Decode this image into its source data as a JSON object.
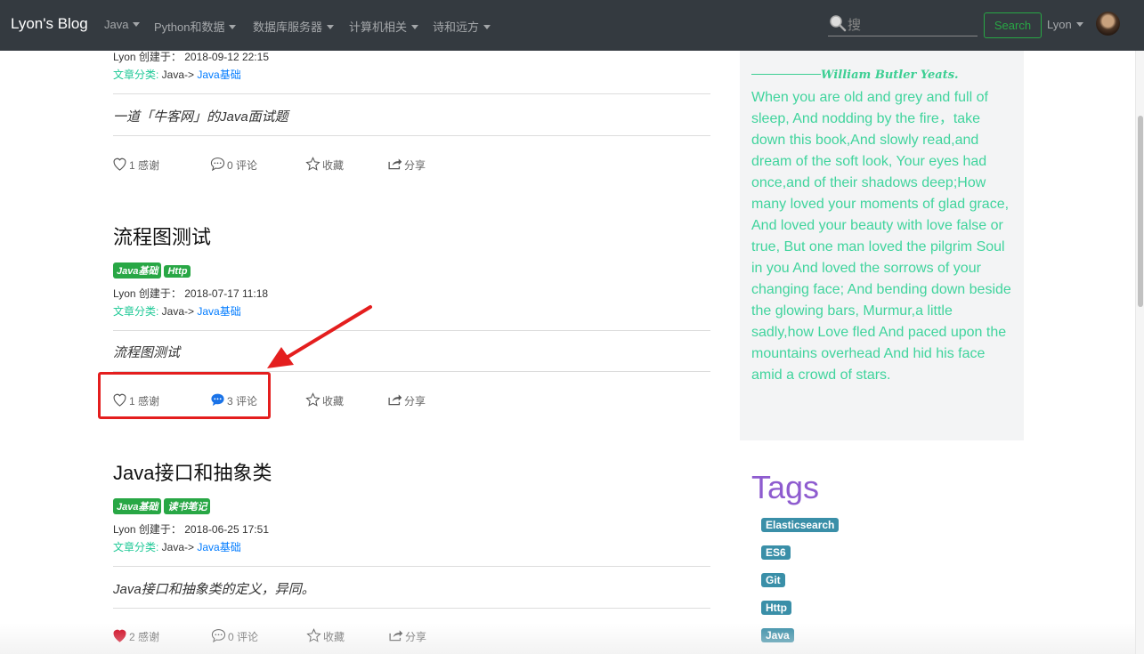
{
  "navbar": {
    "brand": "Lyon's Blog",
    "items": [
      "Java",
      "Python和数据",
      "数据库服务器",
      "计算机相关",
      "诗和远方"
    ],
    "search_placeholder": "搜",
    "search_button": "Search",
    "user": "Lyon"
  },
  "posts": [
    {
      "meta": "Lyon 创建于：  2018-09-12 22:15",
      "category_label": "文章分类:",
      "category_path": " Java-> ",
      "category_link": "Java基础",
      "summary": "一道「牛客网」的Java面试题",
      "likes": "1 感谢",
      "comments": "0 评论",
      "favorite": "收藏",
      "share": "分享"
    },
    {
      "title": "流程图测试",
      "tags": [
        "Java基础",
        "Http"
      ],
      "meta": "Lyon 创建于：  2018-07-17 11:18",
      "category_label": "文章分类:",
      "category_path": " Java-> ",
      "category_link": "Java基础",
      "summary": "流程图测试",
      "likes": "1 感谢",
      "comments": "3 评论",
      "favorite": "收藏",
      "share": "分享"
    },
    {
      "title": "Java接口和抽象类",
      "tags": [
        "Java基础",
        "读书笔记"
      ],
      "meta": "Lyon 创建于：  2018-06-25 17:51",
      "category_label": "文章分类:",
      "category_path": " Java-> ",
      "category_link": "Java基础",
      "summary": "Java接口和抽象类的定义，异同。",
      "likes": "2 感谢",
      "comments": "0 评论",
      "favorite": "收藏",
      "share": "分享"
    }
  ],
  "sidebar": {
    "poem_author": "William Butler Yeats.",
    "poem_text": "When you are old and grey and full of sleep, And nodding by the fire，take down this book,And slowly read,and dream of the soft look, Your eyes had once,and of their shadows deep;How many loved your moments of glad grace, And loved your beauty with love false or true, But one man loved the pilgrim Soul in you And loved the sorrows of your changing face; And bending down beside the glowing bars, Murmur,a little sadly,how Love fled And paced upon the mountains overhead And hid his face amid a crowd of stars.",
    "tags_heading": "Tags",
    "tags": [
      "Elasticsearch",
      "ES6",
      "Git",
      "Http",
      "Java"
    ]
  },
  "colors": {
    "navbar_bg": "#343a40",
    "post_tag": "#28a745",
    "side_tag": "#3a8fa8",
    "poem_text": "#40d49d",
    "tags_heading": "#8e5ccf",
    "highlight": "#e41e1e",
    "liked_heart": "#d0021b",
    "active_comment": "#1a73e8"
  },
  "icons": [
    "search-icon",
    "heart-icon",
    "comment-icon",
    "star-icon",
    "share-icon",
    "chevron-down-icon"
  ]
}
